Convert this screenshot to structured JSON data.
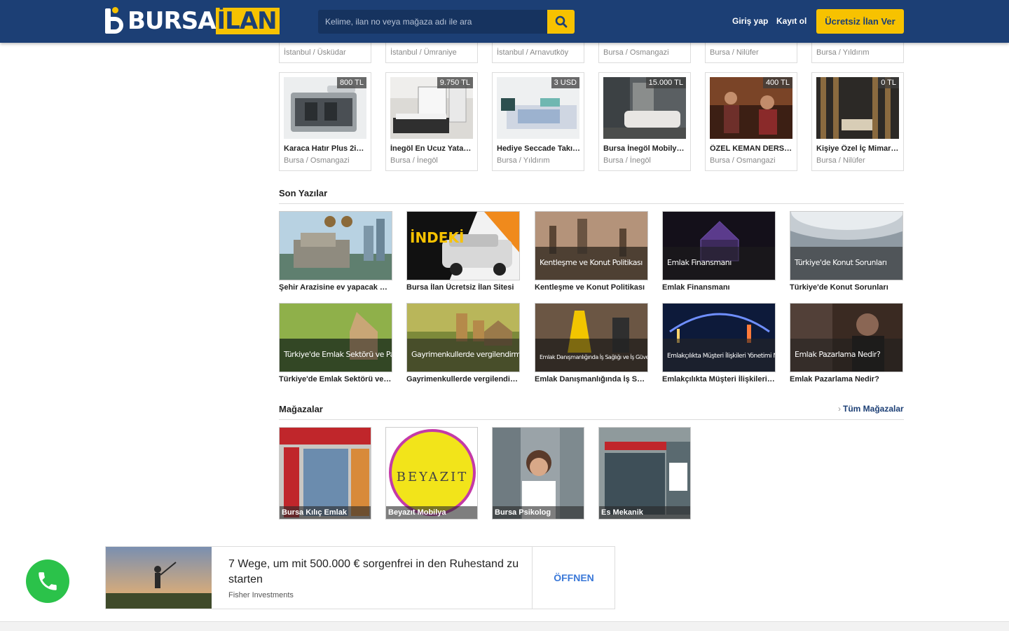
{
  "header": {
    "logo_part1": "BURSA",
    "logo_part2": "İLAN",
    "search_placeholder": "Kelime, ilan no veya mağaza adı ile ara",
    "login": "Giriş yap",
    "register": "Kayıt ol",
    "post_ad": "Ücretsiz İlan Ver",
    "colors": {
      "header_bg": "#1c3f75",
      "accent": "#f7c200"
    }
  },
  "top_cut_cards": [
    {
      "loc": "İstanbul / Üsküdar"
    },
    {
      "loc": "İstanbul / Ümraniye"
    },
    {
      "loc": "İstanbul / Arnavutköy"
    },
    {
      "loc": "Bursa / Osmangazi"
    },
    {
      "loc": "Bursa / Nilüfer"
    },
    {
      "loc": "Bursa / Yıldırım"
    }
  ],
  "listings": [
    {
      "price": "800 TL",
      "title": "Karaca Hatır Plus 2in1 ...",
      "loc": "Bursa / Osmangazi"
    },
    {
      "price": "9.750 TL",
      "title": "İnegöl En Ucuz Yatak ...",
      "loc": "Bursa / İnegöl"
    },
    {
      "price": "3 USD",
      "title": "Hediye Seccade Takım...",
      "loc": "Bursa / Yıldırım"
    },
    {
      "price": "15.000 TL",
      "title": "Bursa İnegöl Mobilya F...",
      "loc": "Bursa / İnegöl"
    },
    {
      "price": "400 TL",
      "title": "ÖZEL KEMAN DERSİ ...",
      "loc": "Bursa / Osmangazi"
    },
    {
      "price": "0 TL",
      "title": "Kişiye Özel İç Mimarlı...",
      "loc": "Bursa / Nilüfer"
    }
  ],
  "posts_section": {
    "title": "Son Yazılar"
  },
  "posts": [
    {
      "title": "Şehir Arazisine ev yapacak müt...",
      "overlay": ""
    },
    {
      "title": "Bursa İlan Ücretsiz İlan Sitesi",
      "overlay": ""
    },
    {
      "title": "Kentleşme ve Konut Politikası",
      "overlay": "Kentleşme ve Konut Politikası"
    },
    {
      "title": "Emlak Finansmanı",
      "overlay": "Emlak Finansmanı"
    },
    {
      "title": "Türkiye'de Konut Sorunları",
      "overlay": "Türkiye'de Konut Sorunları"
    },
    {
      "title": "Türkiye'de Emlak Sektörü ve Pa...",
      "overlay": "Türkiye'de Emlak Sektörü ve Pazar Yapısı"
    },
    {
      "title": "Gayrimenkullerde vergilendirme",
      "overlay": "Gayrimenkullerde vergilendirme"
    },
    {
      "title": "Emlak Danışmanlığında İş Sağlı...",
      "overlay": "Emlak Danışmanlığında İş Sağlığı ve İş Güvenliği"
    },
    {
      "title": "Emlakçılıkta Müşteri İlişkileri Y...",
      "overlay": "Emlakçılıkta Müşteri İlişkileri Yönetimi Nedir?"
    },
    {
      "title": "Emlak Pazarlama Nedir?",
      "overlay": "Emlak Pazarlama Nedir?"
    }
  ],
  "post_extra": {
    "suv_text": "İNDEKİ"
  },
  "stores_section": {
    "title": "Mağazalar",
    "all_link": "Tüm Mağazalar"
  },
  "stores": [
    {
      "name": "Bursa Kılıç Emlak"
    },
    {
      "name": "Beyazıt Mobilya"
    },
    {
      "name": "Bursa Psikolog"
    },
    {
      "name": "Es Mekanik"
    }
  ],
  "ad": {
    "headline": "7 Wege, um mit 500.000 € sorgenfrei in den Ruhestand zu starten",
    "source": "Fisher Investments",
    "cta": "ÖFFNEN"
  }
}
